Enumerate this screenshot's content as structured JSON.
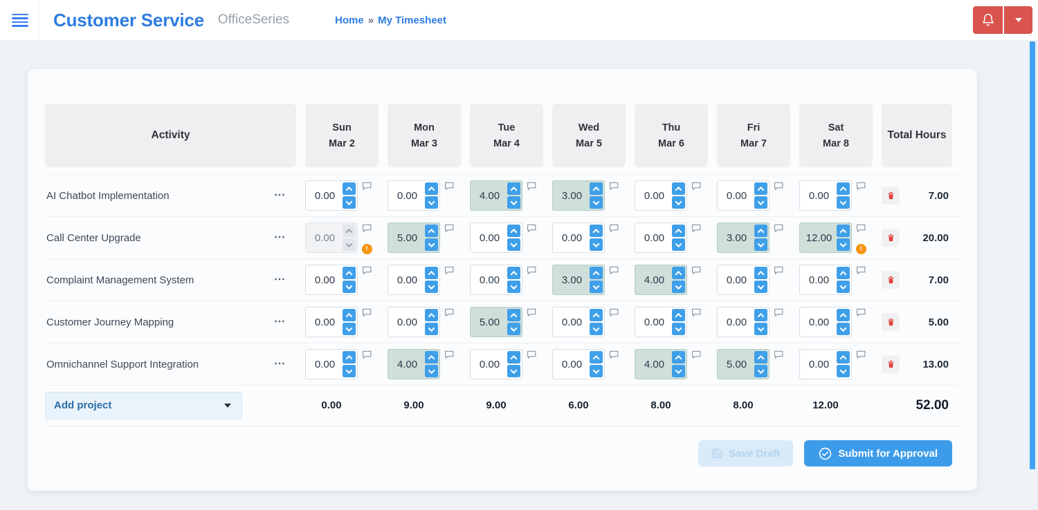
{
  "app": {
    "title": "Customer Service",
    "suite": "OfficeSeries",
    "breadcrumb": {
      "home": "Home",
      "separator": "»",
      "current": "My Timesheet"
    }
  },
  "icons": {
    "menu": "hamburger",
    "notifications": "bell",
    "account_menu": "chevron-down",
    "comment": "speech-bubble",
    "warning": "orange-exclamation-circle",
    "delete_row": "trash",
    "save": "floppy-disk",
    "submit": "check-circle"
  },
  "colors": {
    "brand_blue": "#2e7ce2",
    "accent_blue": "#3f9fe9",
    "alert_red": "#d9544d",
    "warning_orange": "#f7940a",
    "highlight_teal": "#cfe0db",
    "scrollbar_blue": "#42a1f5"
  },
  "timesheet": {
    "activity_header": "Activity",
    "total_header": "Total Hours",
    "row_menu_glyph": "⋯",
    "warning_glyph": "!",
    "days": [
      {
        "name": "Sun",
        "date": "Mar 2"
      },
      {
        "name": "Mon",
        "date": "Mar 3"
      },
      {
        "name": "Tue",
        "date": "Mar 4"
      },
      {
        "name": "Wed",
        "date": "Mar 5"
      },
      {
        "name": "Thu",
        "date": "Mar 6"
      },
      {
        "name": "Fri",
        "date": "Mar 7"
      },
      {
        "name": "Sat",
        "date": "Mar 8"
      }
    ],
    "rows": [
      {
        "activity": "AI Chatbot Implementation",
        "hours": [
          "0.00",
          "0.00",
          "4.00",
          "3.00",
          "0.00",
          "0.00",
          "0.00"
        ],
        "total": "7.00",
        "disabled_cols": [],
        "warning_cols": []
      },
      {
        "activity": "Call Center Upgrade",
        "hours": [
          "0.00",
          "5.00",
          "0.00",
          "0.00",
          "0.00",
          "3.00",
          "12.00"
        ],
        "total": "20.00",
        "disabled_cols": [
          0
        ],
        "warning_cols": [
          0,
          6
        ]
      },
      {
        "activity": "Complaint Management System",
        "hours": [
          "0.00",
          "0.00",
          "0.00",
          "3.00",
          "4.00",
          "0.00",
          "0.00"
        ],
        "total": "7.00",
        "disabled_cols": [],
        "warning_cols": []
      },
      {
        "activity": "Customer Journey Mapping",
        "hours": [
          "0.00",
          "0.00",
          "5.00",
          "0.00",
          "0.00",
          "0.00",
          "0.00"
        ],
        "total": "5.00",
        "disabled_cols": [],
        "warning_cols": []
      },
      {
        "activity": "Omnichannel Support Integration",
        "hours": [
          "0.00",
          "4.00",
          "0.00",
          "0.00",
          "4.00",
          "5.00",
          "0.00"
        ],
        "total": "13.00",
        "disabled_cols": [],
        "warning_cols": []
      }
    ],
    "footer": {
      "add_project_label": "Add project",
      "day_totals": [
        "0.00",
        "9.00",
        "9.00",
        "6.00",
        "8.00",
        "8.00",
        "12.00"
      ],
      "grand_total": "52.00"
    },
    "actions": {
      "save_draft": "Save Draft",
      "submit": "Submit for Approval"
    }
  }
}
